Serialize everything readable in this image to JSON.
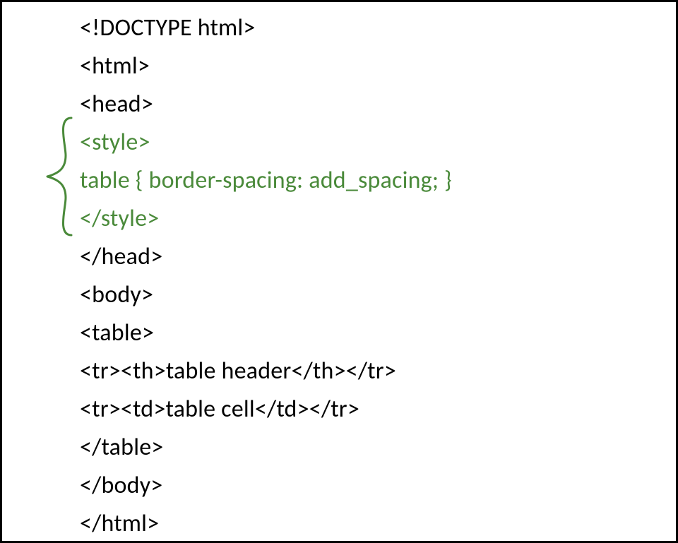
{
  "code": {
    "lines": [
      {
        "text": "<!DOCTYPE html>",
        "highlight": false
      },
      {
        "text": "<html>",
        "highlight": false
      },
      {
        "text": "<head>",
        "highlight": false
      },
      {
        "text": "<style>",
        "highlight": true
      },
      {
        "text": "table { border-spacing: add_spacing; }",
        "highlight": true
      },
      {
        "text": "</style>",
        "highlight": true
      },
      {
        "text": "</head>",
        "highlight": false
      },
      {
        "text": "<body>",
        "highlight": false
      },
      {
        "text": "<table>",
        "highlight": false
      },
      {
        "text": "<tr><th>table header</th></tr>",
        "highlight": false
      },
      {
        "text": "<tr><td>table cell</td></tr>",
        "highlight": false
      },
      {
        "text": "</table>",
        "highlight": false
      },
      {
        "text": "</body>",
        "highlight": false
      },
      {
        "text": "</html>",
        "highlight": false
      }
    ]
  },
  "colors": {
    "highlight": "#4a8a3a",
    "normal": "#000000",
    "border": "#000000"
  }
}
